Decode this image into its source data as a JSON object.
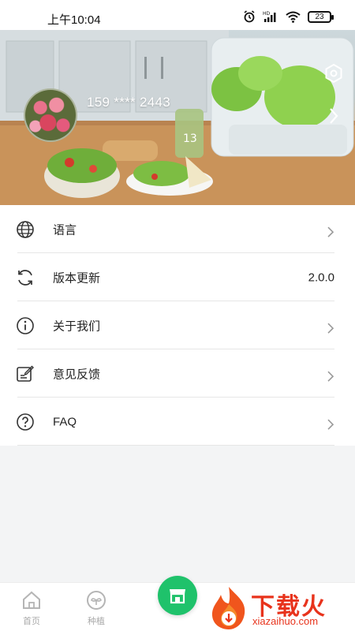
{
  "status_bar": {
    "time": "上午10:04",
    "battery": "23",
    "icons": [
      "alarm-icon",
      "hd-signal-icon",
      "wifi-icon",
      "battery-icon"
    ]
  },
  "profile": {
    "phone": "159 **** 2443",
    "avatar": "flowers-avatar",
    "settings_icon": "hexagon-settings-icon"
  },
  "menu": {
    "items": [
      {
        "label": "语言",
        "icon": "globe-icon",
        "value": null,
        "chevron": true
      },
      {
        "label": "版本更新",
        "icon": "refresh-icon",
        "value": "2.0.0",
        "chevron": false
      },
      {
        "label": "关于我们",
        "icon": "info-icon",
        "value": null,
        "chevron": true
      },
      {
        "label": "意见反馈",
        "icon": "feedback-edit-icon",
        "value": null,
        "chevron": true
      },
      {
        "label": "FAQ",
        "icon": "question-icon",
        "value": null,
        "chevron": true
      }
    ]
  },
  "tabbar": {
    "home_label": "首页",
    "plant_label": "种植",
    "center_icon": "store-icon"
  },
  "watermark": {
    "title": "下载火",
    "subtitle": "xiazaihuo.com"
  },
  "colors": {
    "accent": "#1fc26b",
    "watermark": "#e8331c",
    "divider": "#e6e6e6"
  }
}
